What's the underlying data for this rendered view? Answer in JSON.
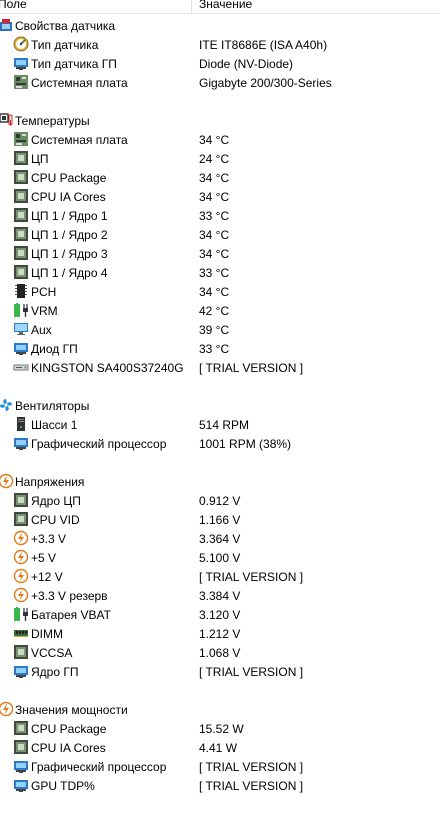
{
  "header": {
    "col_field": "Поле",
    "col_value": "Значение"
  },
  "sections": [
    {
      "title": "Свойства датчика",
      "icon": "sensor-properties-icon",
      "items": [
        {
          "label": "Тип датчика",
          "value": "ITE IT8686E  (ISA A40h)",
          "icon": "gauge-icon"
        },
        {
          "label": "Тип датчика ГП",
          "value": "Diode  (NV-Diode)",
          "icon": "gpu-card-icon"
        },
        {
          "label": "Системная плата",
          "value": "Gigabyte 200/300-Series",
          "icon": "motherboard-icon"
        }
      ]
    },
    {
      "title": "Температуры",
      "icon": "thermometer-icon",
      "items": [
        {
          "label": "Системная плата",
          "value": "34 °C",
          "icon": "motherboard-icon"
        },
        {
          "label": "ЦП",
          "value": "24 °C",
          "icon": "cpu-chip-icon"
        },
        {
          "label": "CPU Package",
          "value": "34 °C",
          "icon": "cpu-chip-icon"
        },
        {
          "label": "CPU IA Cores",
          "value": "34 °C",
          "icon": "cpu-chip-icon"
        },
        {
          "label": "ЦП 1 / Ядро 1",
          "value": "33 °C",
          "icon": "cpu-chip-icon"
        },
        {
          "label": "ЦП 1 / Ядро 2",
          "value": "34 °C",
          "icon": "cpu-chip-icon"
        },
        {
          "label": "ЦП 1 / Ядро 3",
          "value": "34 °C",
          "icon": "cpu-chip-icon"
        },
        {
          "label": "ЦП 1 / Ядро 4",
          "value": "33 °C",
          "icon": "cpu-chip-icon"
        },
        {
          "label": "PCH",
          "value": "34 °C",
          "icon": "pch-chip-icon"
        },
        {
          "label": "VRM",
          "value": "42 °C",
          "icon": "battery-plug-icon"
        },
        {
          "label": "Aux",
          "value": "39 °C",
          "icon": "monitor-icon"
        },
        {
          "label": "Диод ГП",
          "value": "33 °C",
          "icon": "gpu-card-icon"
        },
        {
          "label": "KINGSTON SA400S37240G",
          "value": "[ TRIAL VERSION ]",
          "icon": "drive-icon"
        }
      ]
    },
    {
      "title": "Вентиляторы",
      "icon": "fan-icon",
      "items": [
        {
          "label": "Шасси 1",
          "value": "514 RPM",
          "icon": "chassis-icon"
        },
        {
          "label": "Графический процессор",
          "value": "1001 RPM  (38%)",
          "icon": "gpu-card-icon"
        }
      ]
    },
    {
      "title": "Напряжения",
      "icon": "voltage-icon",
      "items": [
        {
          "label": "Ядро ЦП",
          "value": "0.912 V",
          "icon": "cpu-chip-icon"
        },
        {
          "label": "CPU VID",
          "value": "1.166 V",
          "icon": "cpu-chip-icon"
        },
        {
          "label": "+3.3 V",
          "value": "3.364 V",
          "icon": "voltage-icon"
        },
        {
          "label": "+5 V",
          "value": "5.100 V",
          "icon": "voltage-icon"
        },
        {
          "label": "+12 V",
          "value": "[ TRIAL VERSION ]",
          "icon": "voltage-icon"
        },
        {
          "label": "+3.3 V резерв",
          "value": "3.384 V",
          "icon": "voltage-icon"
        },
        {
          "label": "Батарея VBAT",
          "value": "3.120 V",
          "icon": "battery-plug-icon"
        },
        {
          "label": "DIMM",
          "value": "1.212 V",
          "icon": "memory-icon"
        },
        {
          "label": "VCCSA",
          "value": "1.068 V",
          "icon": "cpu-chip-icon"
        },
        {
          "label": "Ядро ГП",
          "value": "[ TRIAL VERSION ]",
          "icon": "gpu-card-icon"
        }
      ]
    },
    {
      "title": "Значения мощности",
      "icon": "voltage-icon",
      "items": [
        {
          "label": "CPU Package",
          "value": "15.52 W",
          "icon": "cpu-chip-icon"
        },
        {
          "label": "CPU IA Cores",
          "value": "4.41 W",
          "icon": "cpu-chip-icon"
        },
        {
          "label": "Графический процессор",
          "value": "[ TRIAL VERSION ]",
          "icon": "gpu-card-icon"
        },
        {
          "label": "GPU TDP%",
          "value": "[ TRIAL VERSION ]",
          "icon": "gpu-card-icon"
        }
      ]
    }
  ]
}
